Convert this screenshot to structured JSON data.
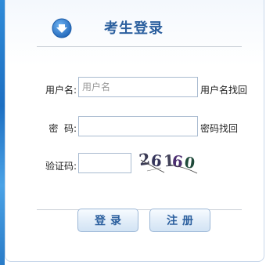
{
  "header": {
    "title": "考生登录",
    "icon": "download-arrow-icon"
  },
  "form": {
    "username": {
      "label": "用户名:",
      "placeholder": "用户名",
      "value": "",
      "recover_link": "用户名找回"
    },
    "password": {
      "label": "密  码:",
      "value": "",
      "recover_link": "密码找回"
    },
    "captcha": {
      "label": "验证码:",
      "value": "",
      "image_text": "26160"
    }
  },
  "actions": {
    "login_label": "登录",
    "register_label": "注册"
  },
  "colors": {
    "title": "#2b5f9e",
    "icon_blue": "#2a7bd0",
    "border": "#a9bbd0"
  }
}
